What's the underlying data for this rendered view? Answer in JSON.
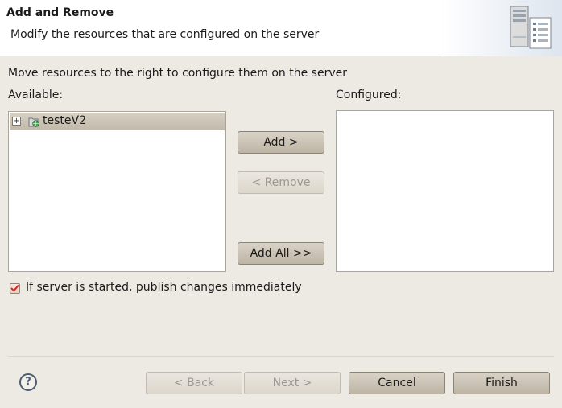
{
  "header": {
    "title": "Add and Remove",
    "description": "Modify the resources that are configured on the server",
    "image_icon": "server-wizard-icon"
  },
  "main": {
    "instruction": "Move resources to the right to configure them on the server",
    "available_label": "Available:",
    "configured_label": "Configured:",
    "available_items": [
      {
        "label": "testeV2",
        "icon": "web-project-icon",
        "expanded": false,
        "selected": true
      }
    ],
    "configured_items": []
  },
  "transfer_buttons": {
    "add": "Add >",
    "remove": "< Remove",
    "add_all": "Add All >>"
  },
  "options": {
    "publish_label": "If server is started, publish changes immediately",
    "publish_checked": true
  },
  "footer": {
    "help_icon": "help-icon",
    "back": "< Back",
    "next": "Next >",
    "cancel": "Cancel",
    "finish": "Finish"
  },
  "colors": {
    "background": "#edeae4",
    "selection": "#c8c0b1",
    "checkbox_mark": "#cc2a1a"
  }
}
